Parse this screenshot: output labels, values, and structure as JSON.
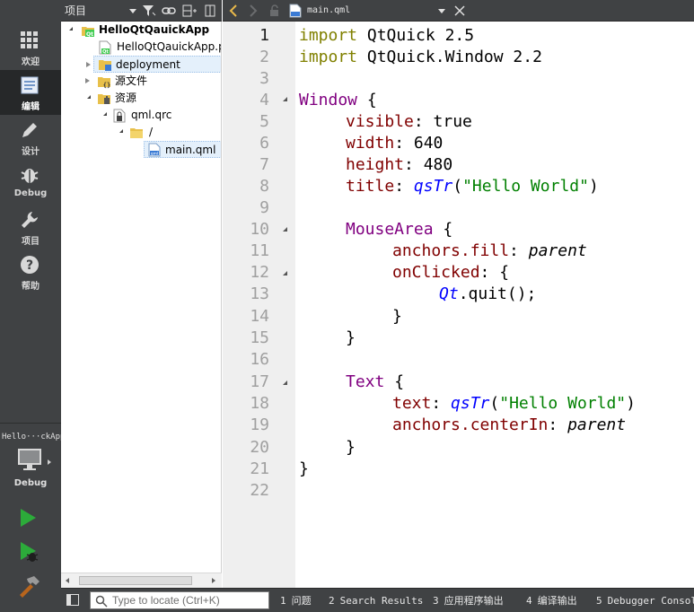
{
  "modebar": {
    "modes": [
      {
        "label": "欢迎",
        "icon": "grid-icon"
      },
      {
        "label": "编辑",
        "icon": "document-icon"
      },
      {
        "label": "设计",
        "icon": "pencil-icon"
      },
      {
        "label": "Debug",
        "icon": "bug-icon"
      },
      {
        "label": "项目",
        "icon": "wrench-icon"
      },
      {
        "label": "帮助",
        "icon": "help-icon"
      }
    ],
    "active_mode": "编辑",
    "target_name": "Hello···ckApp",
    "build_config": "Debug"
  },
  "project_panel": {
    "view_selector": "项目",
    "tree": [
      {
        "label": "HelloQtQauickApp",
        "bold": true
      },
      {
        "label": "HelloQtQauickApp.p"
      },
      {
        "label": "deployment"
      },
      {
        "label": "源文件"
      },
      {
        "label": "资源"
      },
      {
        "label": "qml.qrc"
      },
      {
        "label": "/"
      },
      {
        "label": "main.qml"
      }
    ]
  },
  "editor": {
    "document_name": "main.qml",
    "current_line": 1,
    "line_numbers": [
      "1",
      "2",
      "3",
      "4",
      "5",
      "6",
      "7",
      "8",
      "9",
      "10",
      "11",
      "12",
      "13",
      "14",
      "15",
      "16",
      "17",
      "18",
      "19",
      "20",
      "21",
      "22"
    ],
    "code": {
      "l1_kw": "import",
      "l1_rest": " QtQuick 2.5",
      "l2_kw": "import",
      "l2_rest": " QtQuick.Window 2.2",
      "l4_type": "Window",
      "l4_rest": " {",
      "l5_prop": "visible",
      "l5_sep": ": ",
      "l5_val": "true",
      "l6_prop": "width",
      "l6_sep": ": ",
      "l6_val": "640",
      "l7_prop": "height",
      "l7_sep": ": ",
      "l7_val": "480",
      "l8_prop": "title",
      "l8_sep": ": ",
      "l8_fn": "qsTr",
      "l8_open": "(",
      "l8_str": "\"Hello World\"",
      "l8_close": ")",
      "l10_type": "MouseArea",
      "l10_rest": " {",
      "l11_prop": "anchors.fill",
      "l11_sep": ": ",
      "l11_val": "parent",
      "l12_prop": "onClicked",
      "l12_rest": ": {",
      "l13_obj": "Qt",
      "l13_rest": ".quit();",
      "l14": "}",
      "l15": "}",
      "l17_type": "Text",
      "l17_rest": " {",
      "l18_prop": "text",
      "l18_sep": ": ",
      "l18_fn": "qsTr",
      "l18_open": "(",
      "l18_str": "\"Hello World\"",
      "l18_close": ")",
      "l19_prop": "anchors.centerIn",
      "l19_sep": ": ",
      "l19_val": "parent",
      "l20": "}",
      "l21": "}"
    }
  },
  "statusbar": {
    "locator_placeholder": "Type to locate (Ctrl+K)",
    "output_tabs": [
      {
        "num": "1",
        "label": "问题"
      },
      {
        "num": "2",
        "label": "Search Results"
      },
      {
        "num": "3",
        "label": "应用程序输出"
      },
      {
        "num": "4",
        "label": "编译输出"
      },
      {
        "num": "5",
        "label": "Debugger Console"
      }
    ]
  },
  "colors": {
    "sidebar_bg": "#404244",
    "keyword": "#808000",
    "type": "#800080",
    "property": "#800000",
    "function": "#0000ff",
    "string": "#008000",
    "run_green": "#2cab3a"
  }
}
